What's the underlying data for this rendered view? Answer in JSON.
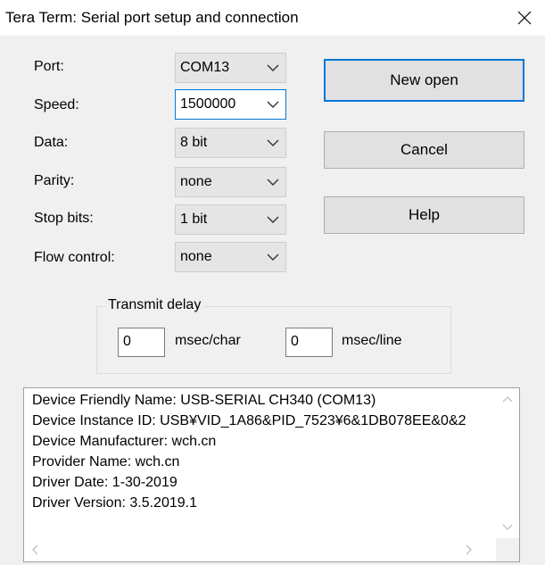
{
  "window": {
    "title": "Tera Term: Serial port setup and connection",
    "close_icon": "close-icon"
  },
  "settings": {
    "port": {
      "label": "Port:",
      "value": "COM13"
    },
    "speed": {
      "label": "Speed:",
      "value": "1500000"
    },
    "data": {
      "label": "Data:",
      "value": "8 bit"
    },
    "parity": {
      "label": "Parity:",
      "value": "none"
    },
    "stop": {
      "label": "Stop bits:",
      "value": "1 bit"
    },
    "flow": {
      "label": "Flow control:",
      "value": "none"
    }
  },
  "buttons": {
    "new_open": "New open",
    "cancel": "Cancel",
    "help": "Help"
  },
  "transmit_delay": {
    "title": "Transmit delay",
    "char_value": "0",
    "char_unit": "msec/char",
    "line_value": "0",
    "line_unit": "msec/line"
  },
  "device_info": [
    "Device Friendly Name: USB-SERIAL CH340 (COM13)",
    "Device Instance ID: USB¥VID_1A86&PID_7523¥6&1DB078EE&0&2",
    "Device Manufacturer: wch.cn",
    "Provider Name: wch.cn",
    "Driver Date: 1-30-2019",
    "Driver Version: 3.5.2019.1"
  ],
  "colors": {
    "focus_border": "#0078d7",
    "dialog_bg": "#f0f0f0"
  }
}
